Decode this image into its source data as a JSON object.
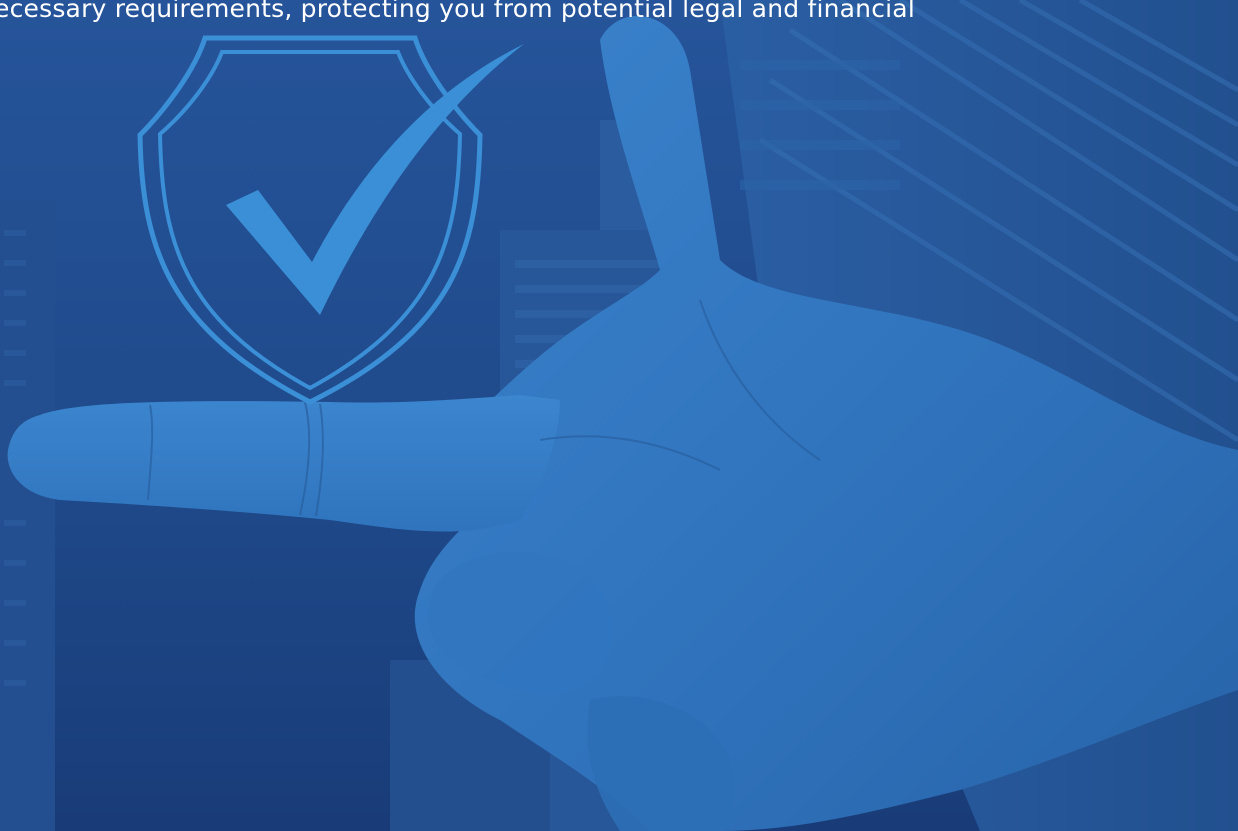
{
  "hero": {
    "text": "ecessary requirements, protecting you from potential legal and financial"
  },
  "colors": {
    "background": "#1f4b8c",
    "shield": "#3a8fd6",
    "hand": "#2f73bd",
    "text": "#ffffff"
  },
  "icons": {
    "shield": "shield-check-icon"
  }
}
